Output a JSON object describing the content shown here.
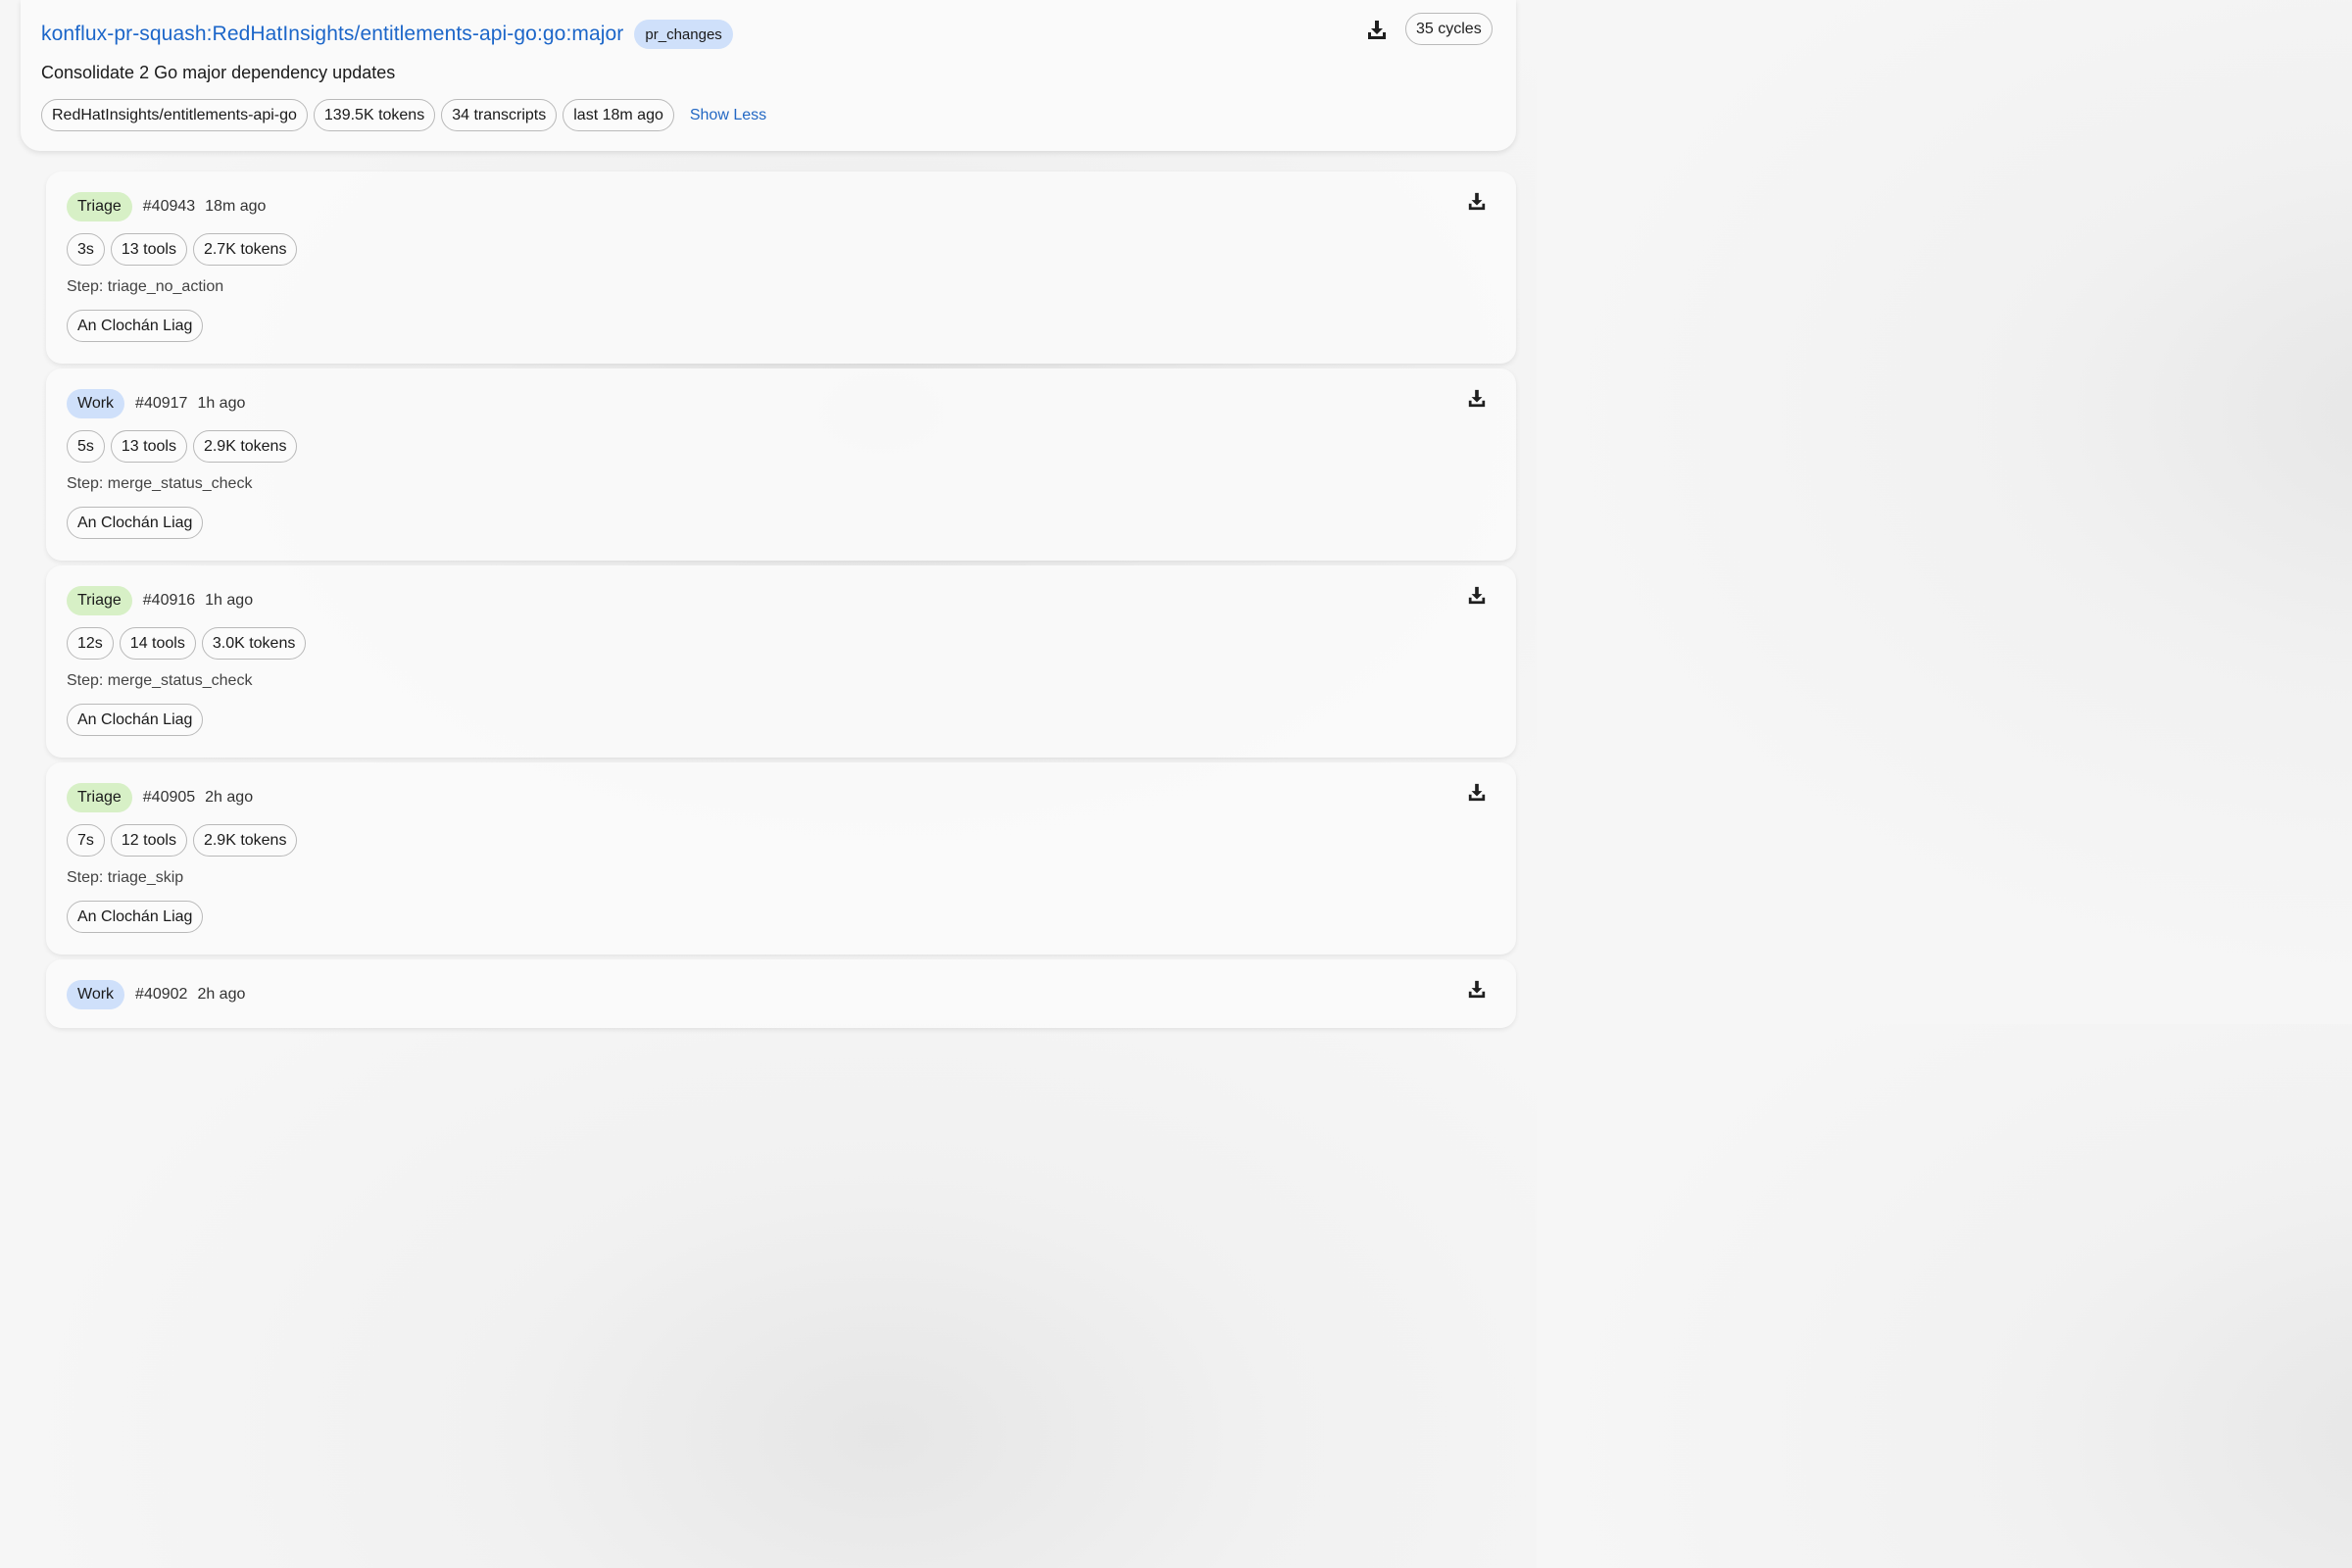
{
  "header": {
    "title": "konflux-pr-squash:RedHatInsights/entitlements-api-go:go:major",
    "badge": "pr_changes",
    "subtitle": "Consolidate 2 Go major dependency updates",
    "chips": [
      "RedHatInsights/entitlements-api-go",
      "139.5K tokens",
      "34 transcripts",
      "last 18m ago"
    ],
    "show_less": "Show Less",
    "cycles": "35 cycles",
    "download_icon": "download-icon"
  },
  "runs": [
    {
      "type": "Triage",
      "id": "#40943",
      "ago": "18m ago",
      "duration": "3s",
      "tools": "13 tools",
      "tokens": "2.7K tokens",
      "step": "Step: triage_no_action",
      "owner": "An Clochán Liag"
    },
    {
      "type": "Work",
      "id": "#40917",
      "ago": "1h ago",
      "duration": "5s",
      "tools": "13 tools",
      "tokens": "2.9K tokens",
      "step": "Step: merge_status_check",
      "owner": "An Clochán Liag"
    },
    {
      "type": "Triage",
      "id": "#40916",
      "ago": "1h ago",
      "duration": "12s",
      "tools": "14 tools",
      "tokens": "3.0K tokens",
      "step": "Step: merge_status_check",
      "owner": "An Clochán Liag"
    },
    {
      "type": "Triage",
      "id": "#40905",
      "ago": "2h ago",
      "duration": "7s",
      "tools": "12 tools",
      "tokens": "2.9K tokens",
      "step": "Step: triage_skip",
      "owner": "An Clochán Liag"
    },
    {
      "type": "Work",
      "id": "#40902",
      "ago": "2h ago"
    }
  ],
  "colors": {
    "link": "#1c66c9",
    "triage_tag": "#d7f0c6",
    "work_tag": "#cfe0fa"
  }
}
